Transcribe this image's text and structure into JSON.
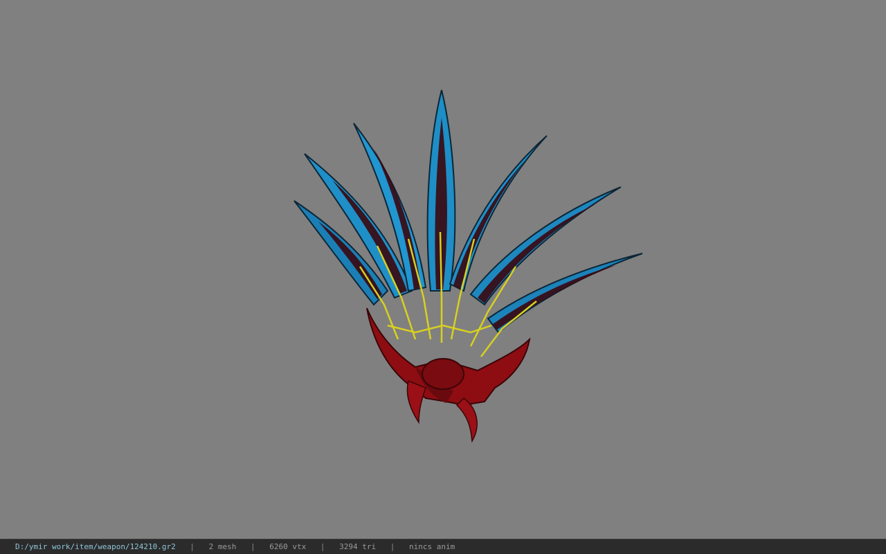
{
  "viewport": {
    "background_color": "#808080",
    "model": {
      "description_icon": "spiked-fan-weapon-model",
      "colors": {
        "blade_blue": "#1f8fc8",
        "blade_dark": "#102a3a",
        "inner_red": "#5a0a10",
        "base_red": "#8e0d12",
        "ornament_yellow": "#d8d020"
      }
    }
  },
  "statusbar": {
    "file_path": "D:/ymir work/item/weapon/124210.gr2",
    "separator": "|",
    "mesh": "2 mesh",
    "vertices": "6260 vtx",
    "triangles": "3294 tri",
    "anim": "nincs anim"
  }
}
